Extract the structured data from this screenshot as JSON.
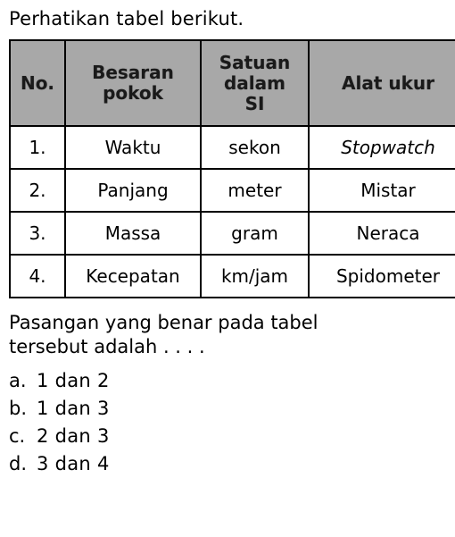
{
  "intro": "Perhatikan tabel berikut.",
  "table": {
    "headers": [
      "No.",
      "Besaran pokok",
      "Satuan dalam SI",
      "Alat ukur"
    ],
    "header_lines": [
      [
        "No."
      ],
      [
        "Besaran",
        "pokok"
      ],
      [
        "Satuan",
        "dalam",
        "SI"
      ],
      [
        "Alat ukur"
      ]
    ],
    "rows": [
      {
        "no": "1.",
        "besaran": "Waktu",
        "satuan": "sekon",
        "alat": "Stopwatch",
        "alat_italic": true
      },
      {
        "no": "2.",
        "besaran": "Panjang",
        "satuan": "meter",
        "alat": "Mistar",
        "alat_italic": false
      },
      {
        "no": "3.",
        "besaran": "Massa",
        "satuan": "gram",
        "alat": "Neraca",
        "alat_italic": false
      },
      {
        "no": "4.",
        "besaran": "Kecepatan",
        "satuan": "km/jam",
        "alat": "Spidometer",
        "alat_italic": false
      }
    ]
  },
  "question": {
    "line1": "Pasangan yang benar pada tabel",
    "line2": "tersebut adalah . . . ."
  },
  "choices": [
    {
      "letter": "a.",
      "text": "1 dan 2"
    },
    {
      "letter": "b.",
      "text": "1 dan 3"
    },
    {
      "letter": "c.",
      "text": "2 dan 3"
    },
    {
      "letter": "d.",
      "text": "3 dan 4"
    }
  ]
}
